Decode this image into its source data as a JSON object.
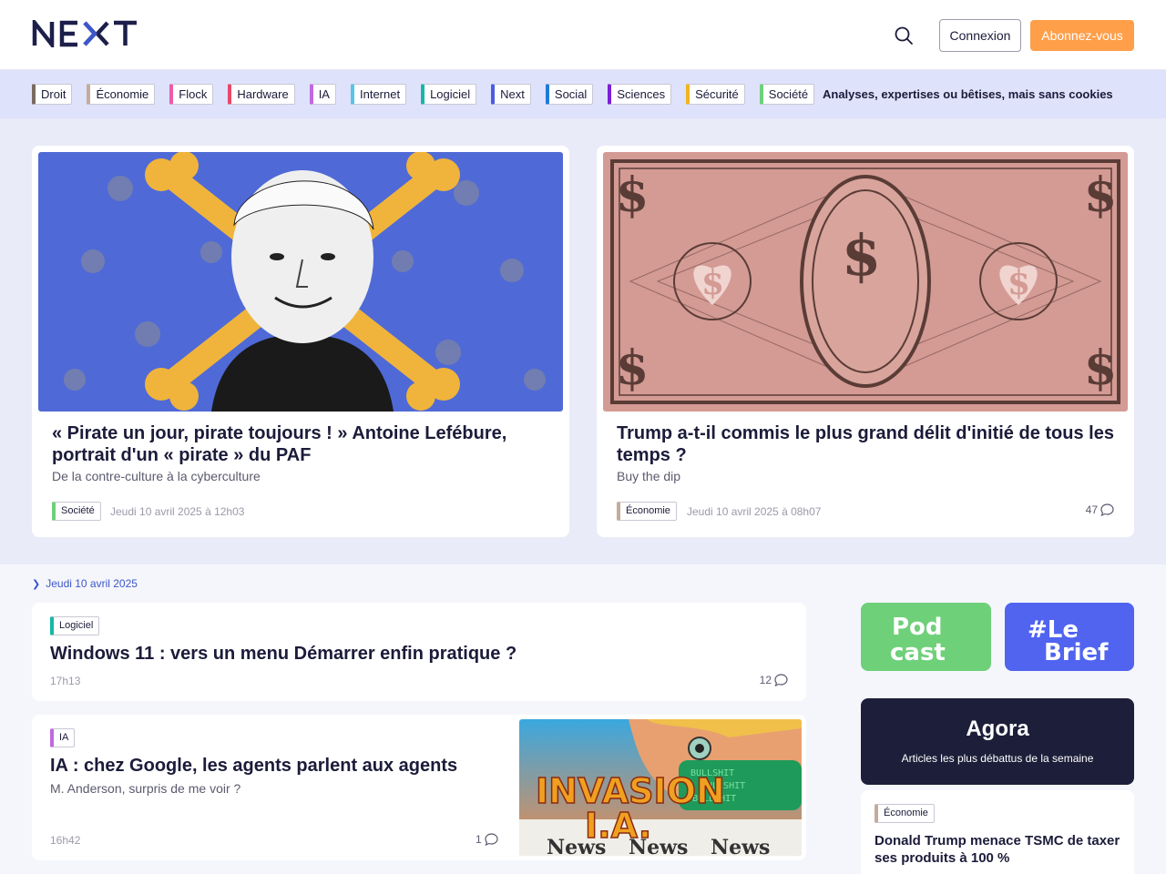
{
  "header": {
    "logo_text": "NEXT",
    "login_label": "Connexion",
    "subscribe_label": "Abonnez-vous"
  },
  "categories": [
    {
      "label": "Droit",
      "color": "#7a6a5e"
    },
    {
      "label": "Économie",
      "color": "#c4ab9a"
    },
    {
      "label": "Flock",
      "color": "#ee5aa8"
    },
    {
      "label": "Hardware",
      "color": "#e8476a"
    },
    {
      "label": "IA",
      "color": "#c069e0"
    },
    {
      "label": "Internet",
      "color": "#57c4e8"
    },
    {
      "label": "Logiciel",
      "color": "#17b7a6"
    },
    {
      "label": "Next",
      "color": "#4a5de0"
    },
    {
      "label": "Social",
      "color": "#1f7bd6"
    },
    {
      "label": "Sciences",
      "color": "#7a1fd6"
    },
    {
      "label": "Sécurité",
      "color": "#f0b41f"
    },
    {
      "label": "Société",
      "color": "#6fd07a"
    }
  ],
  "tagline": "Analyses, expertises ou bêtises, mais sans cookies",
  "hero": [
    {
      "title": "« Pirate un jour, pirate toujours ! » Antoine Lefébure, portrait d'un « pirate » du PAF",
      "subtitle": "De la contre-culture à la cyberculture",
      "tag": "Société",
      "tag_color": "#6fd07a",
      "date": "Jeudi 10 avril 2025 à 12h03",
      "comments": ""
    },
    {
      "title": "Trump a-t-il commis le plus grand délit d'initié de tous les temps ?",
      "subtitle": "Buy the dip",
      "tag": "Économie",
      "tag_color": "#c4ab9a",
      "date": "Jeudi 10 avril 2025 à 08h07",
      "comments": "47"
    }
  ],
  "feed": {
    "date_header": "Jeudi 10 avril 2025",
    "articles": [
      {
        "tag": "Logiciel",
        "tag_color": "#17b7a6",
        "title": "Windows 11 : vers un menu Démarrer enfin pratique ?",
        "time": "17h13",
        "comments": "12"
      },
      {
        "tag": "IA",
        "tag_color": "#c069e0",
        "title": "IA : chez Google, les agents parlent aux agents",
        "subtitle": "M. Anderson, surpris de me voir ?",
        "time": "16h42",
        "comments": "1",
        "image_text_1": "INVASION",
        "image_text_2": "I.A."
      }
    ]
  },
  "sidebar": {
    "podcast_label_1": "Pod",
    "podcast_label_2": "cast",
    "brief_label_1": "#Le",
    "brief_label_2": "Brief",
    "agora_name": "Agora",
    "agora_desc": "Articles les plus débattus de la semaine",
    "featured": {
      "tag": "Économie",
      "tag_color": "#c4ab9a",
      "title": "Donald Trump menace TSMC de taxer ses produits à 100 %"
    }
  }
}
